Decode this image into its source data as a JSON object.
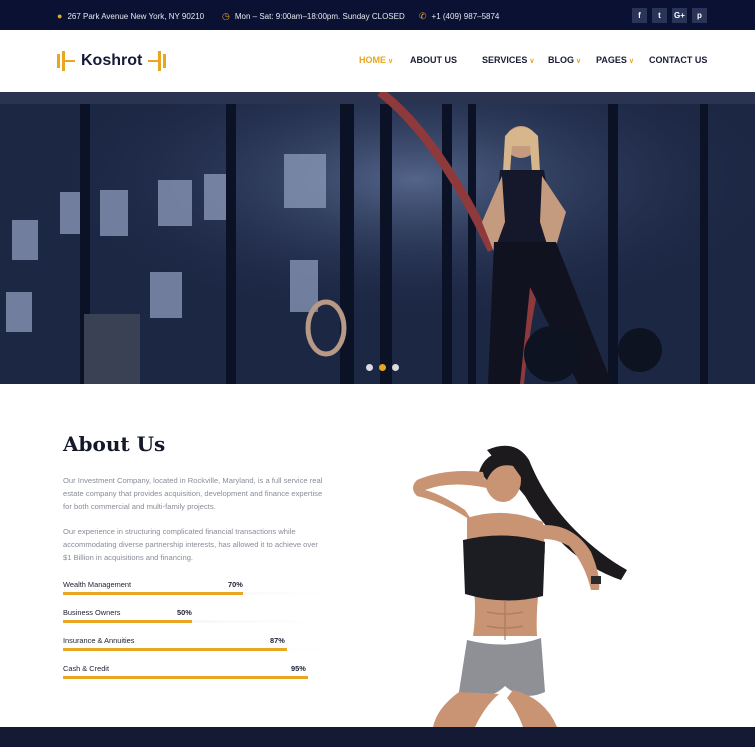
{
  "topbar": {
    "address": "267 Park Avenue New York, NY 90210",
    "hours": "Mon – Sat: 9:00am–18:00pm. Sunday CLOSED",
    "phone": "+1 (409) 987–5874",
    "social": [
      {
        "icon": "facebook-icon",
        "glyph": "f"
      },
      {
        "icon": "twitter-icon",
        "glyph": "t"
      },
      {
        "icon": "google-plus-icon",
        "glyph": "G+"
      },
      {
        "icon": "pinterest-icon",
        "glyph": "p"
      }
    ],
    "accent": "#e9a620"
  },
  "brand": {
    "name": "Koshrot",
    "logo_icon": "dumbbell-icon"
  },
  "nav": [
    {
      "label": "HOME",
      "active": true,
      "dropdown": true
    },
    {
      "label": "ABOUT US",
      "active": false,
      "dropdown": false
    },
    {
      "label": "SERVICES",
      "active": false,
      "dropdown": true
    },
    {
      "label": "BLOG",
      "active": false,
      "dropdown": true
    },
    {
      "label": "PAGES",
      "active": false,
      "dropdown": true
    },
    {
      "label": "CONTACT US",
      "active": false,
      "dropdown": false
    }
  ],
  "hero": {
    "slides": 3,
    "active_slide": 2
  },
  "about": {
    "title": "About Us",
    "paragraph1": "Our Investment Company, located in Rockville, Maryland, is a full service real estate company that provides acquisition, development and finance expertise for both commercial and multi-family projects.",
    "paragraph2": "Our experience in structuring complicated financial transactions while accommodating diverse partnership interests, has allowed it to achieve over $1 Billion in acquisitions and financing.",
    "skills": [
      {
        "label": "Wealth Management",
        "pct_text": "70%",
        "value": 70
      },
      {
        "label": "Business Owners",
        "pct_text": "50%",
        "value": 50
      },
      {
        "label": "Insurance & Annuities",
        "pct_text": "87%",
        "value": 87
      },
      {
        "label": "Cash & Credit",
        "pct_text": "95%",
        "value": 95
      }
    ]
  },
  "colors": {
    "navy": "#0b1133",
    "accent": "#e9a620"
  }
}
